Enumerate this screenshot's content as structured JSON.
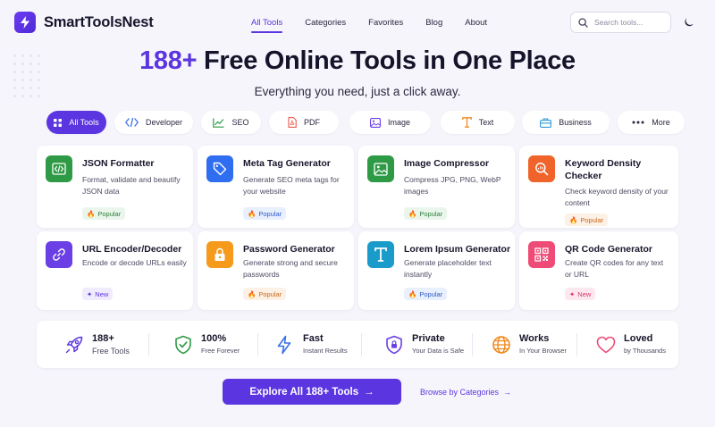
{
  "header": {
    "brand": "SmartToolsNest",
    "nav": [
      "All Tools",
      "Categories",
      "Favorites",
      "Blog",
      "About"
    ],
    "active_nav": "All Tools",
    "search_placeholder": "Search tools..."
  },
  "hero": {
    "title_accent": "188+",
    "title_rest": " Free Online Tools in One Place",
    "subtitle": "Everything you need, just a click away."
  },
  "categories": [
    "All Tools",
    "Developer",
    "SEO",
    "PDF",
    "Image",
    "Text",
    "Business",
    "More"
  ],
  "tools": [
    {
      "title": "JSON Formatter",
      "desc": "Format, validate and beautify JSON data",
      "badge": "Popular",
      "icon": "code-icon",
      "color": "#2e9a45"
    },
    {
      "title": "Meta Tag Generator",
      "desc": "Generate SEO meta tags for your website",
      "badge": "Popular",
      "icon": "tag-icon",
      "color": "#2f6ef0"
    },
    {
      "title": "Image Compressor",
      "desc": "Compress JPG, PNG, WebP images",
      "badge": "Popular",
      "icon": "image-icon",
      "color": "#2e9a45"
    },
    {
      "title": "Keyword Density Checker",
      "desc": "Check keyword density of your content",
      "badge": "Popular",
      "icon": "magnifier-icon",
      "color": "#f0632a"
    },
    {
      "title": "URL Encoder/Decoder",
      "desc": "Encode or decode URLs easily",
      "badge": "New",
      "icon": "link-icon",
      "color": "#6a3fe6"
    },
    {
      "title": "Password Generator",
      "desc": "Generate strong and secure passwords",
      "badge": "Popular",
      "icon": "lock-icon",
      "color": "#f59a1a"
    },
    {
      "title": "Lorem Ipsum Generator",
      "desc": "Generate placeholder text instantly",
      "badge": "Popular",
      "icon": "text-icon",
      "color": "#1a9bc9"
    },
    {
      "title": "QR Code Generator",
      "desc": "Create QR codes for any text or URL",
      "badge": "New",
      "icon": "qr-icon",
      "color": "#ef4b77"
    }
  ],
  "features": [
    {
      "main": "188+",
      "sub": "Free Tools",
      "icon": "rocket-icon"
    },
    {
      "main": "100%",
      "sub": "Free Forever",
      "icon": "shield-check-icon"
    },
    {
      "main": "Fast",
      "sub": "Instant Results",
      "icon": "bolt-icon"
    },
    {
      "main": "Private",
      "sub": "Your Data is Safe",
      "icon": "shield-lock-icon"
    },
    {
      "main": "Works",
      "sub": "In Your Browser",
      "icon": "globe-icon"
    },
    {
      "main": "Loved",
      "sub": "by Thousands",
      "icon": "heart-icon"
    }
  ],
  "cta": {
    "primary": "Explore All 188+ Tools",
    "secondary": "Browse by Categories"
  },
  "colors": {
    "accent": "#5b35e0",
    "background": "#f6f5fb"
  }
}
